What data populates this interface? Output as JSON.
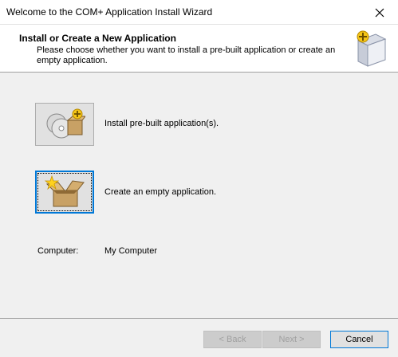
{
  "window": {
    "title": "Welcome to the COM+ Application Install Wizard"
  },
  "header": {
    "title": "Install or Create a New Application",
    "description": "Please choose whether you want to install a pre-built application or create an empty application."
  },
  "options": [
    {
      "label": "Install pre-built application(s).",
      "icon": "cd-box-icon"
    },
    {
      "label": "Create an empty application.",
      "icon": "new-box-icon"
    }
  ],
  "computer": {
    "label": "Computer:",
    "value": "My Computer"
  },
  "buttons": {
    "back": "< Back",
    "next": "Next >",
    "cancel": "Cancel"
  },
  "colors": {
    "accent": "#0078d7",
    "disabled_text": "#a0a0a0"
  }
}
